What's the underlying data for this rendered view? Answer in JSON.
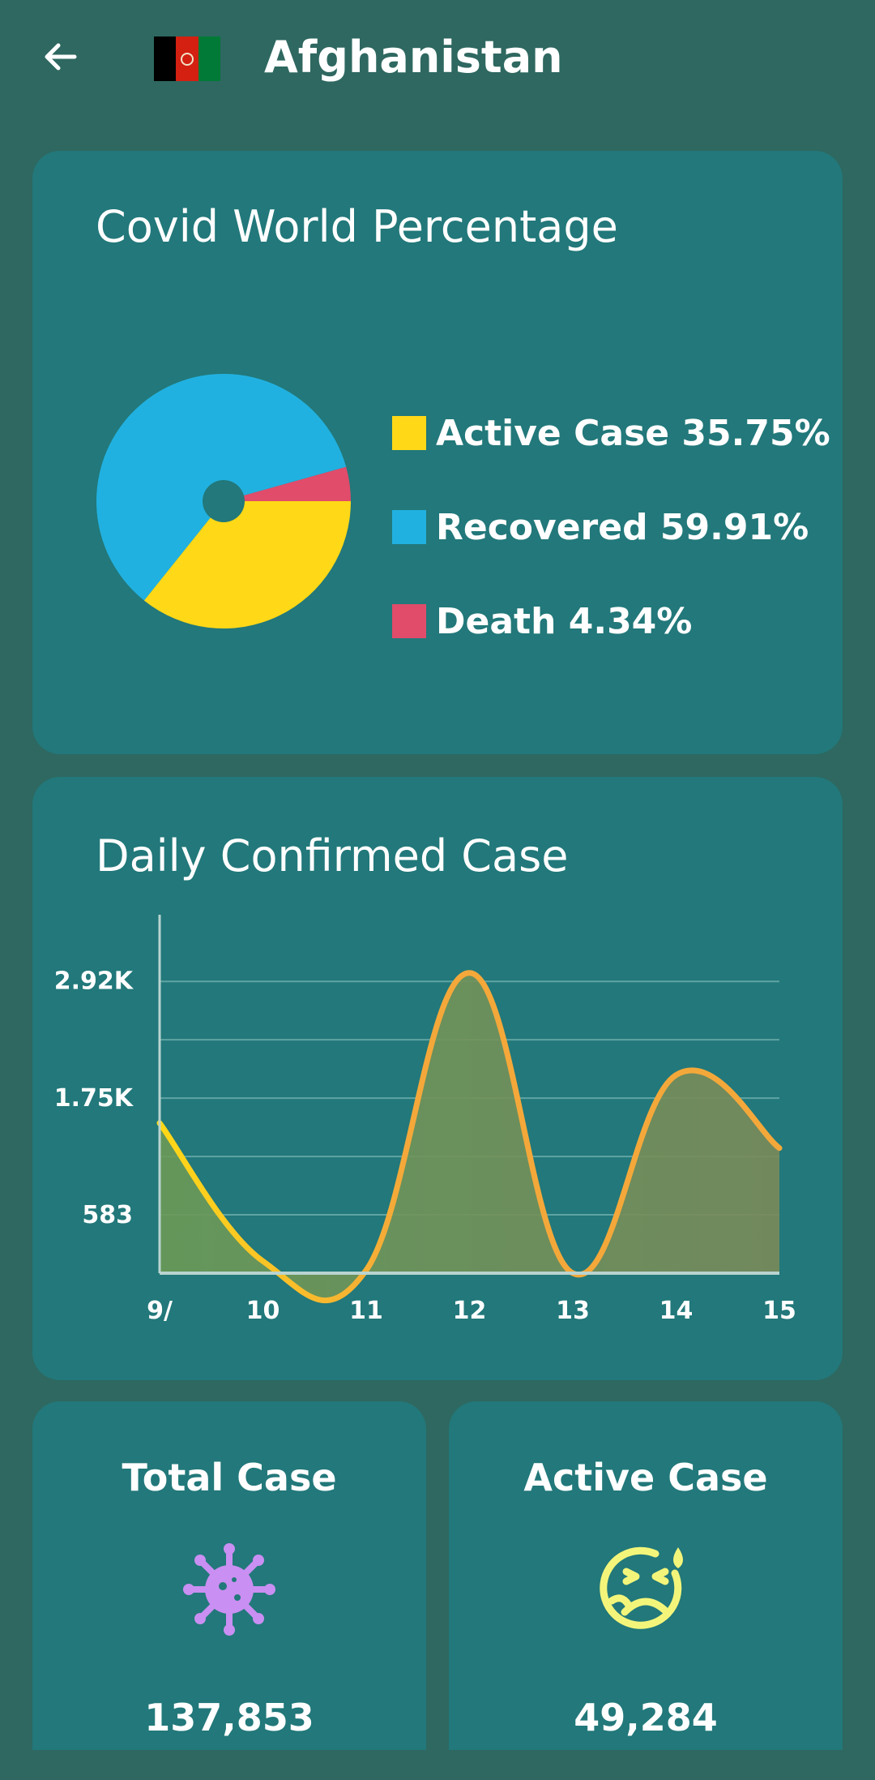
{
  "header": {
    "title": "Afghanistan",
    "back_icon": "arrow-left-icon",
    "flag": {
      "colors": [
        "#000000",
        "#d32011",
        "#007a36"
      ]
    }
  },
  "world_percentage": {
    "title": "Covid World Percentage",
    "legend": [
      {
        "label": "Active Case 35.75%",
        "color": "#ffd817"
      },
      {
        "label": "Recovered 59.91%",
        "color": "#21b1e0"
      },
      {
        "label": "Death 4.34%",
        "color": "#e04c6a"
      }
    ]
  },
  "daily_confirmed": {
    "title": "Daily Confirmed Case",
    "line_color": "#f4a83a",
    "line_start_color": "#ffd817",
    "fill_color": "#7a8a5a"
  },
  "stats": {
    "total": {
      "title": "Total Case",
      "value": "137,853",
      "icon": "virus-icon",
      "icon_color": "#c98ff2"
    },
    "active": {
      "title": "Active Case",
      "value": "49,284",
      "icon": "sick-face-icon",
      "icon_color": "#f3f57a"
    }
  },
  "chart_data": [
    {
      "type": "pie",
      "title": "Covid World Percentage",
      "categories": [
        "Active Case",
        "Recovered",
        "Death"
      ],
      "values": [
        35.75,
        59.91,
        4.34
      ],
      "legend_position": "right"
    },
    {
      "type": "area",
      "title": "Daily Confirmed Case",
      "x": [
        "9/",
        "10",
        "11",
        "12",
        "13",
        "14",
        "15"
      ],
      "series": [
        {
          "values": [
            1500,
            120,
            30,
            3000,
            0,
            1980,
            1250
          ]
        }
      ],
      "ylim": [
        0,
        3500
      ],
      "yticks": [
        583,
        1750,
        2920
      ],
      "ytick_labels": [
        "583",
        "1.75K",
        "2.92K"
      ],
      "grid": true
    }
  ]
}
